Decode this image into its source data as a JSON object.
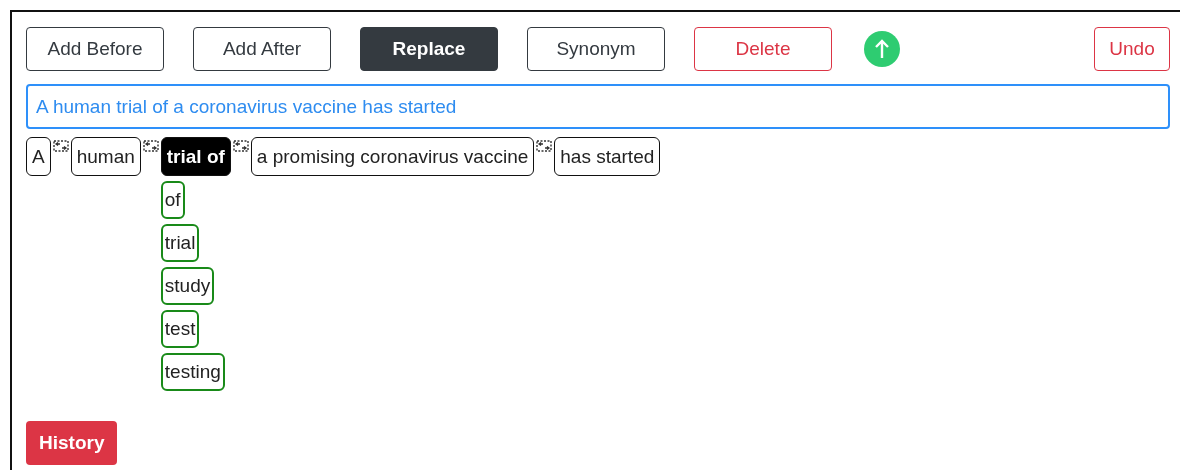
{
  "toolbar": [
    {
      "label": "Add Before",
      "kind": "outline-dark"
    },
    {
      "label": "Add After",
      "kind": "outline-dark"
    },
    {
      "label": "Replace",
      "kind": "dark"
    },
    {
      "label": "Synonym",
      "kind": "outline-dark"
    },
    {
      "label": "Delete",
      "kind": "outline-red"
    },
    {
      "kind": "up-circle"
    },
    {
      "label": "Undo",
      "kind": "outline-red"
    }
  ],
  "sentence_field": {
    "value": "A human trial of a coronavirus vaccine has started"
  },
  "chunks": [
    {
      "text": "A",
      "selected": false
    },
    {
      "text": "human",
      "selected": false
    },
    {
      "text": "trial of",
      "selected": true,
      "synonyms": [
        "of",
        "trial",
        "study",
        "test",
        "testing"
      ]
    },
    {
      "text": "a promising coronavirus vaccine",
      "selected": false
    },
    {
      "text": "has started",
      "selected": false
    }
  ],
  "history_button": {
    "label": "History"
  }
}
